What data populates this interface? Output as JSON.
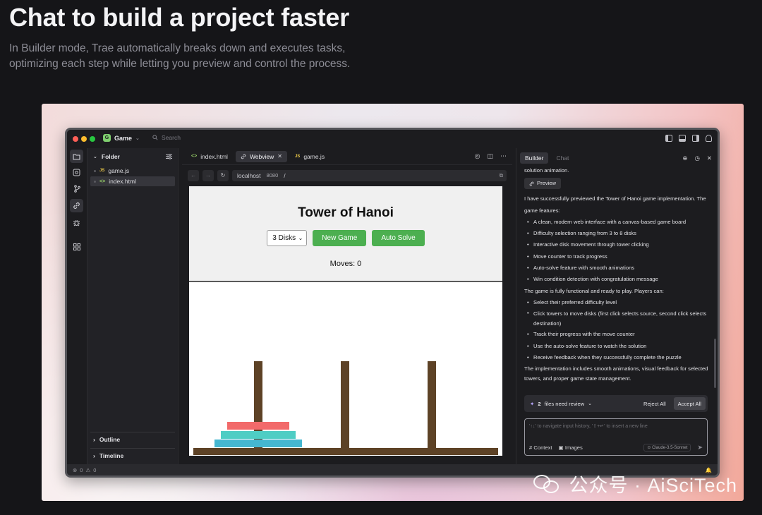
{
  "hero": {
    "title": "Chat to build a project faster",
    "subtitle": "In Builder mode, Trae automatically breaks down and executes tasks, optimizing each step while letting you preview and control the process."
  },
  "titlebar": {
    "project_badge": "G",
    "project_name": "Game",
    "search_placeholder": "Search"
  },
  "explorer": {
    "folder_label": "Folder",
    "files": [
      {
        "name": "game.js",
        "type": "JS"
      },
      {
        "name": "index.html",
        "type": "<>"
      }
    ],
    "outline_label": "Outline",
    "timeline_label": "Timeline"
  },
  "editor": {
    "tabs": [
      {
        "label": "index.html",
        "icon": "<>"
      },
      {
        "label": "Webview",
        "icon": "link"
      },
      {
        "label": "game.js",
        "icon": "JS"
      }
    ],
    "url": {
      "host": "localhost",
      "port": "8080",
      "path": "/"
    }
  },
  "game": {
    "title": "Tower of Hanoi",
    "disks_select": "3 Disks",
    "new_game": "New Game",
    "auto_solve": "Auto Solve",
    "moves": "Moves: 0",
    "colors": {
      "button": "#4caf50",
      "rod": "#5d4226",
      "disk_red": "#f26a6a",
      "disk_teal": "#4ecdc4",
      "disk_blue": "#45b7d1"
    }
  },
  "assistant": {
    "tabs": [
      "Builder",
      "Chat"
    ],
    "top_text": "solution animation.",
    "preview_button": "Preview",
    "intro": "I have successfully previewed the Tower of Hanoi game implementation. The game features:",
    "features": [
      "A clean, modern web interface with a canvas-based game board",
      "Difficulty selection ranging from 3 to 8 disks",
      "Interactive disk movement through tower clicking",
      "Move counter to track progress",
      "Auto-solve feature with smooth animations",
      "Win condition detection with congratulation message"
    ],
    "players_intro": "The game is fully functional and ready to play. Players can:",
    "player_items": [
      "Select their preferred difficulty level",
      "Click towers to move disks (first click selects source, second click selects destination)",
      "Track their progress with the move counter",
      "Use the auto-solve feature to watch the solution",
      "Receive feedback when they successfully complete the puzzle"
    ],
    "closing": "The implementation includes smooth animations, visual feedback for selected towers, and proper game state management.",
    "review": {
      "count": "2",
      "label": "files need review",
      "reject": "Reject All",
      "accept": "Accept All"
    },
    "input": {
      "placeholder": "'↑↓' to navigate input history, '⇧+↵' to insert a new line",
      "context": "Context",
      "images": "Images",
      "model": "Claude-3.5-Sonnet"
    }
  },
  "status": {
    "errors": "0",
    "warnings": "0"
  },
  "watermark": "公众号 · AiSciTech"
}
